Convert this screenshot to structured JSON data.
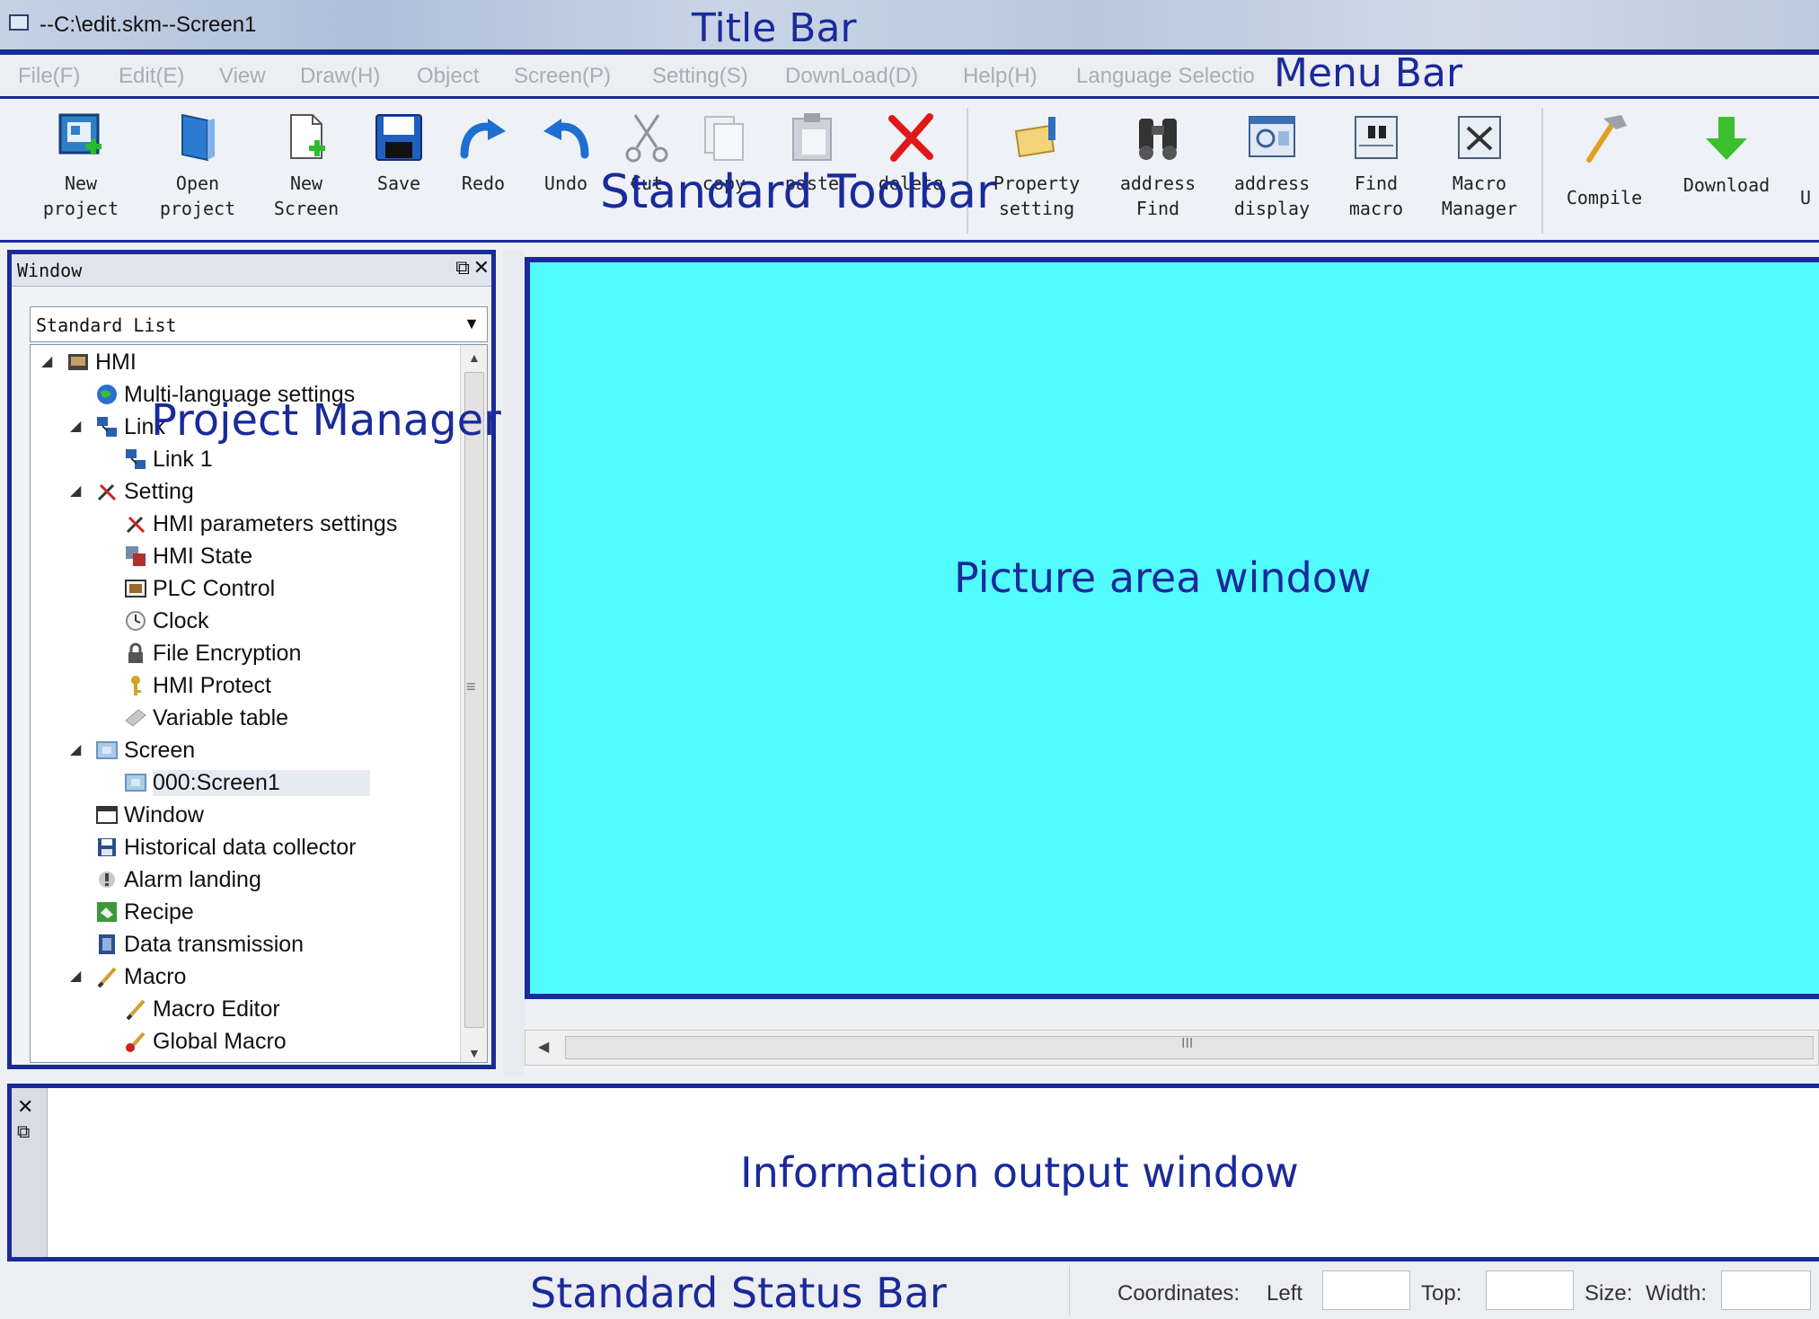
{
  "title_bar": {
    "title": "--C:\\edit.skm--Screen1"
  },
  "menu": {
    "items": [
      "File(F)",
      "Edit(E)",
      "View",
      "Draw(H)",
      "Object",
      "Screen(P)",
      "Setting(S)",
      "DownLoad(D)",
      "Help(H)",
      "Language Selectio"
    ]
  },
  "toolbar": {
    "new_project": "New\nproject",
    "open_project": "Open\nproject",
    "new_screen": "New\nScreen",
    "save": "Save",
    "redo": "Redo",
    "undo": "Undo",
    "cut": "Cut",
    "copy": "copy",
    "paste": "paste",
    "delete": "delete",
    "property_setting": "Property\nsetting",
    "address_find": "address\nFind",
    "address_display": "address\ndisplay",
    "find_macro": "Find\nmacro",
    "macro_manager": "Macro\nManager",
    "compile": "Compile",
    "download": "Download",
    "upload_partial": "U"
  },
  "project_manager": {
    "panel_title": "Window",
    "view_select": "Standard List",
    "tree": {
      "hmi": "HMI",
      "multi_language": "Multi-language settings",
      "link": "Link",
      "link1": "Link 1",
      "setting": "Setting",
      "hmi_parameters": "HMI parameters settings",
      "hmi_state": "HMI State",
      "plc_control": "PLC Control",
      "clock": "Clock",
      "file_encryption": "File Encryption",
      "hmi_protect": "HMI Protect",
      "variable_table": "Variable table",
      "screen": "Screen",
      "screen1": "000:Screen1",
      "window": "Window",
      "historical": "Historical data collector",
      "alarm": "Alarm landing",
      "recipe": "Recipe",
      "data_transmission": "Data transmission",
      "macro": "Macro",
      "macro_editor": "Macro Editor",
      "global_macro": "Global Macro"
    }
  },
  "status_bar": {
    "coordinates": "Coordinates:",
    "left": "Left",
    "top": "Top:",
    "size": "Size:",
    "width": "Width:"
  },
  "annotations": {
    "title_bar": "Title Bar",
    "menu_bar": "Menu Bar",
    "standard_toolbar": "Standard Toolbar",
    "project_manager": "Project Manager",
    "picture_area": "Picture area window",
    "information_output": "Information output window",
    "status_bar": "Standard Status Bar"
  },
  "colors": {
    "annotation_blue": "#1a2a9a",
    "picture_area_bg": "#52fcfd"
  }
}
